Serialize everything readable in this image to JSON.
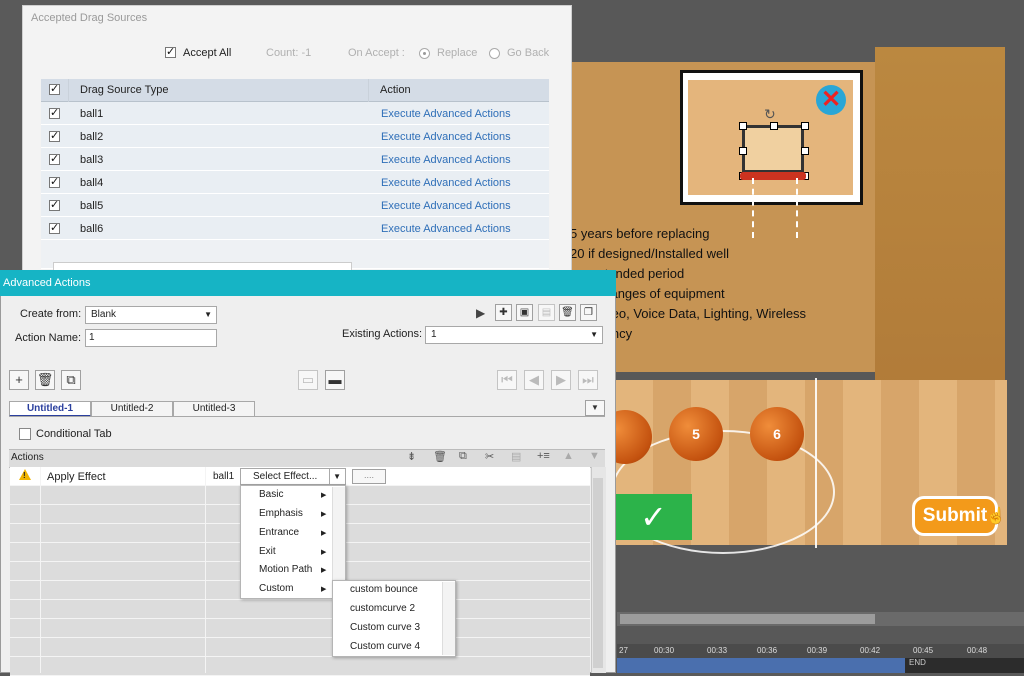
{
  "stage": {
    "bullets": [
      "5 years before replacing",
      "20 if designed/Installed well",
      "r extended period",
      "d Changes of equipment",
      "s Video, Voice Data, Lighting, Wireless",
      "undancy"
    ],
    "balls": [
      "5",
      "6"
    ],
    "check_glyph": "✓",
    "submit_label": "Submit",
    "close_glyph": "✕",
    "timeline_ticks": [
      "27",
      "00:30",
      "00:33",
      "00:36",
      "00:39",
      "00:42",
      "00:45",
      "00:48"
    ],
    "timeline_end": "END"
  },
  "drag_sources": {
    "title": "Accepted Drag Sources",
    "accept_all_label": "Accept All",
    "count_label": "Count: -1",
    "on_accept_label": "On Accept :",
    "replace_label": "Replace",
    "go_back_label": "Go Back",
    "columns": [
      "Drag Source Type",
      "Action"
    ],
    "rows": [
      {
        "type": "ball1",
        "action": "Execute Advanced Actions"
      },
      {
        "type": "ball2",
        "action": "Execute Advanced Actions"
      },
      {
        "type": "ball3",
        "action": "Execute Advanced Actions"
      },
      {
        "type": "ball4",
        "action": "Execute Advanced Actions"
      },
      {
        "type": "ball5",
        "action": "Execute Advanced Actions"
      },
      {
        "type": "ball6",
        "action": "Execute Advanced Actions"
      }
    ]
  },
  "advanced": {
    "title": "Advanced Actions",
    "create_from_label": "Create from:",
    "create_from_value": "Blank",
    "action_name_label": "Action Name:",
    "action_name_value": "1",
    "existing_label": "Existing Actions:",
    "existing_value": "1",
    "tabs": [
      "Untitled-1",
      "Untitled-2",
      "Untitled-3"
    ],
    "conditional_tab_label": "Conditional Tab",
    "actions_header": "Actions",
    "row": {
      "warning": "!",
      "action": "Apply Effect",
      "target": "ball1",
      "effect_select": "Select Effect...",
      "more": "...."
    },
    "effect_menu": [
      "Basic",
      "Emphasis",
      "Entrance",
      "Exit",
      "Motion Path",
      "Custom"
    ],
    "custom_menu": [
      "custom bounce",
      "customcurve 2",
      "Custom curve 3",
      "Custom curve 4"
    ]
  }
}
